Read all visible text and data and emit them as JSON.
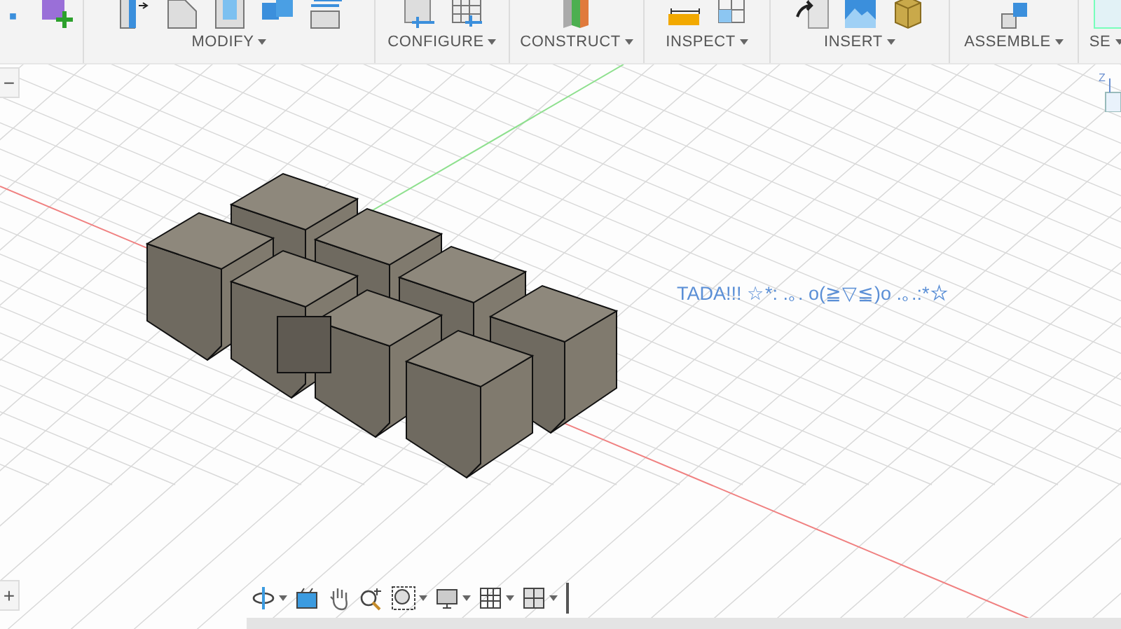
{
  "toolbar": {
    "groups": [
      {
        "label": "MODIFY"
      },
      {
        "label": "CONFIGURE"
      },
      {
        "label": "CONSTRUCT"
      },
      {
        "label": "INSPECT"
      },
      {
        "label": "INSERT"
      },
      {
        "label": "ASSEMBLE"
      },
      {
        "label": "SE"
      }
    ]
  },
  "canvas": {
    "annotation": "TADA!!! ☆*: .｡. o(≧▽≦)o .｡.:*☆",
    "view_cube": {
      "axis_label": "Z"
    }
  },
  "side_controls": {
    "collapse": "−",
    "expand": "+"
  }
}
